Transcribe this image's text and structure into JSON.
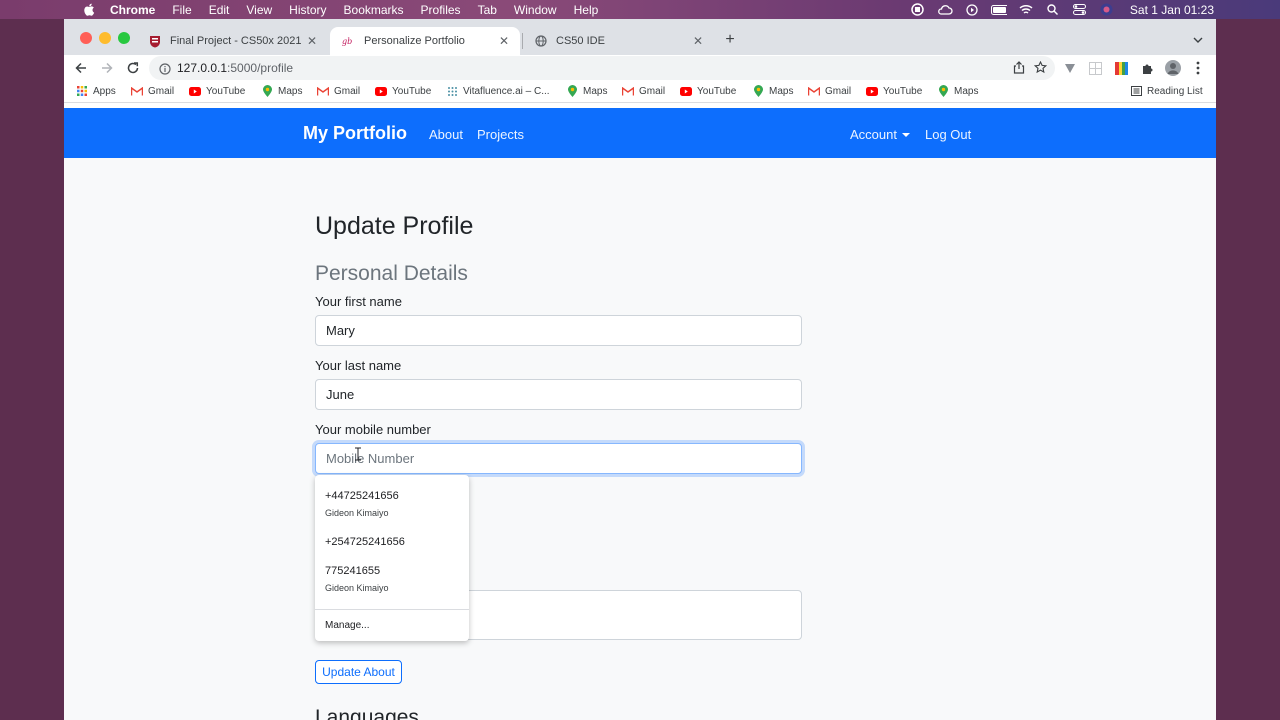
{
  "menubar": {
    "app": "Chrome",
    "items": [
      "File",
      "Edit",
      "View",
      "History",
      "Bookmarks",
      "Profiles",
      "Tab",
      "Window",
      "Help"
    ],
    "clock": "Sat 1 Jan  01:23"
  },
  "tabs": [
    {
      "title": "Final Project - CS50x 2021",
      "icon": "harvard-shield-icon"
    },
    {
      "title": "Personalize Portfolio",
      "icon": "flask-icon"
    },
    {
      "title": "CS50 IDE",
      "icon": "globe-icon"
    }
  ],
  "omnibox": {
    "host": "127.0.0.1",
    "path": ":5000/profile"
  },
  "bookmarks": [
    {
      "label": "Apps",
      "icon": "apps-grid-icon"
    },
    {
      "label": "Gmail",
      "icon": "gmail-icon"
    },
    {
      "label": "YouTube",
      "icon": "youtube-icon"
    },
    {
      "label": "Maps",
      "icon": "maps-pin-icon"
    },
    {
      "label": "Gmail",
      "icon": "gmail-icon"
    },
    {
      "label": "YouTube",
      "icon": "youtube-icon"
    },
    {
      "label": "Vitafluence.ai – C...",
      "icon": "vitafluence-icon"
    },
    {
      "label": "Maps",
      "icon": "maps-pin-icon"
    },
    {
      "label": "Gmail",
      "icon": "gmail-icon"
    },
    {
      "label": "YouTube",
      "icon": "youtube-icon"
    },
    {
      "label": "Maps",
      "icon": "maps-pin-icon"
    },
    {
      "label": "Gmail",
      "icon": "gmail-icon"
    },
    {
      "label": "YouTube",
      "icon": "youtube-icon"
    },
    {
      "label": "Maps",
      "icon": "maps-pin-icon"
    }
  ],
  "reading_list": "Reading List",
  "nav": {
    "brand": "My Portfolio",
    "about": "About",
    "projects": "Projects",
    "account": "Account",
    "logout": "Log Out"
  },
  "form": {
    "heading": "Update Profile",
    "subheading": "Personal Details",
    "first_name_label": "Your first name",
    "first_name_value": "Mary",
    "last_name_label": "Your last name",
    "last_name_value": "June",
    "mobile_label": "Your mobile number",
    "mobile_placeholder": "Mobile Number",
    "update_button": "Update About",
    "languages_heading": "Languages"
  },
  "autofill": {
    "suggestions": [
      {
        "number": "+44725241656",
        "name": "Gideon Kimaiyo"
      },
      {
        "number": "+254725241656",
        "name": ""
      },
      {
        "number": "775241655",
        "name": "Gideon Kimaiyo"
      }
    ],
    "manage": "Manage..."
  },
  "colors": {
    "navbar": "#0d6efd",
    "page_bg": "#f8f9fa",
    "primary": "#0d6efd"
  }
}
